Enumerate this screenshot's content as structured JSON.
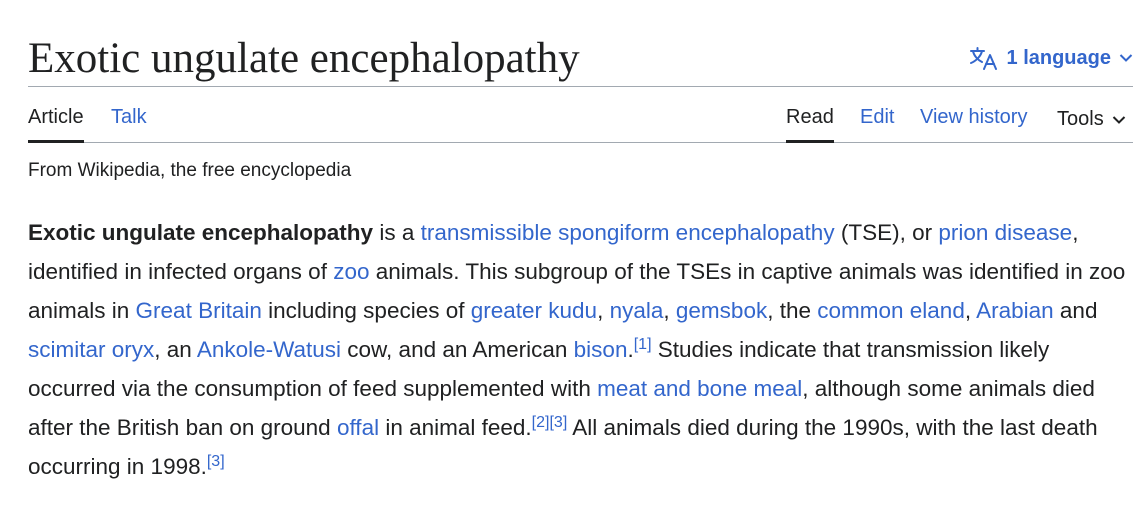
{
  "page": {
    "title": "Exotic ungulate encephalopathy",
    "language_button": "1 language",
    "tagline": "From Wikipedia, the free encyclopedia"
  },
  "tabs": {
    "article": "Article",
    "talk": "Talk",
    "read": "Read",
    "edit": "Edit",
    "view_history": "View history",
    "tools": "Tools"
  },
  "icons": {
    "language": "translate-icon",
    "dropdown": "chevron-down-icon"
  },
  "colors": {
    "link": "#3366cc",
    "text": "#202122",
    "rule": "#a2a9b1"
  },
  "content": {
    "bold_lead": "Exotic ungulate encephalopathy",
    "t1": " is a ",
    "link_tse": "transmissible spongiform encephalopathy",
    "t2": " (TSE), or ",
    "link_prion": "prion disease",
    "t3": ", identified in infected organs of ",
    "link_zoo": "zoo",
    "t4": " animals. This subgroup of the TSEs in captive animals was identified in zoo animals in ",
    "link_gb": "Great Britain",
    "t5": " including species of ",
    "link_kudu": "greater kudu",
    "t6": ", ",
    "link_nyala": "nyala",
    "t7": ", ",
    "link_gemsbok": "gemsbok",
    "t8": ", the ",
    "link_eland": "common eland",
    "t9": ", ",
    "link_arabian": "Arabian",
    "t10": " and ",
    "link_oryx": "scimitar oryx",
    "t11": ", an ",
    "link_ankole": "Ankole-Watusi",
    "t12": " cow, and an American ",
    "link_bison": "bison",
    "t13": ".",
    "ref1": "[1]",
    "t14": " Studies indicate that transmission likely occurred via the consumption of feed supplemented with ",
    "link_mbm": "meat and bone meal",
    "t15": ", although some animals died after the British ban on ground ",
    "link_offal": "offal",
    "t16": " in animal feed.",
    "ref2": "[2]",
    "ref3": "[3]",
    "t17": " All animals died during the 1990s, with the last death occurring in 1998.",
    "ref3b": "[3]"
  }
}
